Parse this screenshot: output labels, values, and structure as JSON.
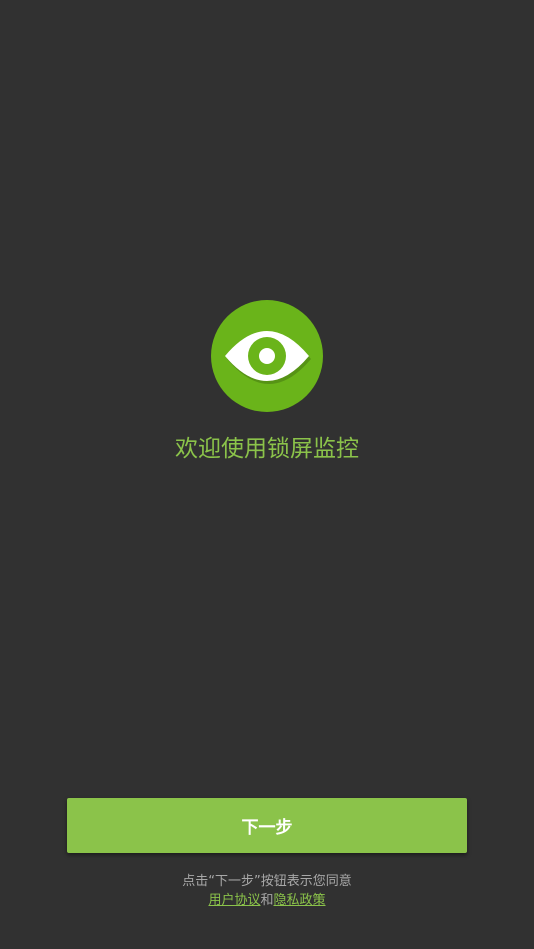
{
  "app": {
    "logo_icon": "eye-icon",
    "welcome_text": "欢迎使用锁屏监控",
    "accent_color": "#8bc34a",
    "logo_color": "#6ab41a",
    "background_color": "#313131"
  },
  "actions": {
    "next_label": "下一步"
  },
  "footer": {
    "consent_text": "点击“下一步”按钮表示您同意",
    "user_agreement_label": "用户协议",
    "conjunction": "和",
    "privacy_policy_label": "隐私政策"
  }
}
